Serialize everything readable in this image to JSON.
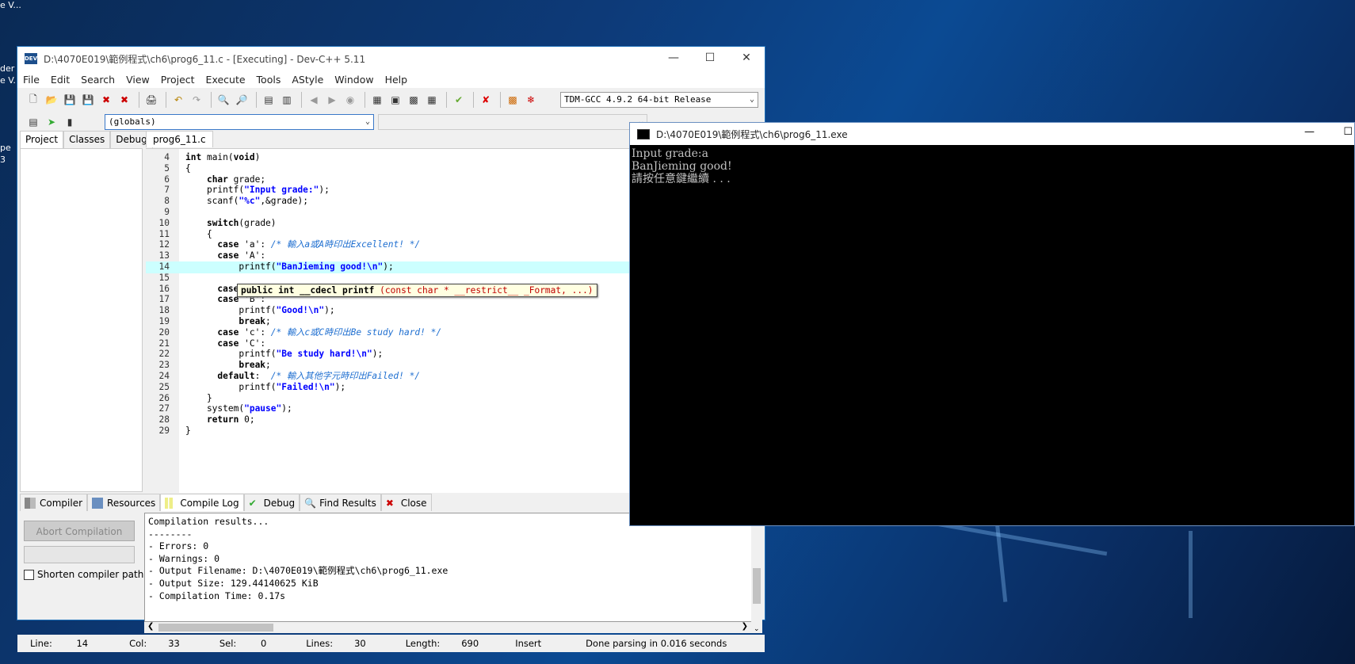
{
  "desktop": {
    "text1": "der",
    "text2": "e V..",
    "text3": "pe",
    "text4": "3",
    "text0": "e V..."
  },
  "devcpp": {
    "title": "D:\\4070E019\\範例程式\\ch6\\prog6_11.c - [Executing] - Dev-C++ 5.11",
    "menu": [
      "File",
      "Edit",
      "Search",
      "View",
      "Project",
      "Execute",
      "Tools",
      "AStyle",
      "Window",
      "Help"
    ],
    "compiler_select": "TDM-GCC 4.9.2 64-bit Release",
    "scope_select": "(globals)",
    "left_tabs": [
      "Project",
      "Classes",
      "Debug"
    ],
    "editor_tab": "prog6_11.c",
    "code_lines": [
      {
        "n": "4",
        "code": "int main(void)"
      },
      {
        "n": "5",
        "code": "{"
      },
      {
        "n": "6",
        "code": "    char grade;"
      },
      {
        "n": "7",
        "code": "    printf(\"Input grade:\");"
      },
      {
        "n": "8",
        "code": "    scanf(\"%c\",&grade);"
      },
      {
        "n": "9",
        "code": ""
      },
      {
        "n": "10",
        "code": "    switch(grade)"
      },
      {
        "n": "11",
        "code": "    {"
      },
      {
        "n": "12",
        "code": "      case 'a': /* 輸入a或A時印出Excellent! */"
      },
      {
        "n": "13",
        "code": "      case 'A':"
      },
      {
        "n": "14",
        "code": "          printf(\"BanJieming good!\\n\");"
      },
      {
        "n": "15",
        "code": ""
      },
      {
        "n": "16",
        "code": "      case 'b': /* 輸入b或B時印出Good! */"
      },
      {
        "n": "17",
        "code": "      case 'B':"
      },
      {
        "n": "18",
        "code": "          printf(\"Good!\\n\");"
      },
      {
        "n": "19",
        "code": "          break;"
      },
      {
        "n": "20",
        "code": "      case 'c': /* 輸入c或C時印出Be study hard! */"
      },
      {
        "n": "21",
        "code": "      case 'C':"
      },
      {
        "n": "22",
        "code": "          printf(\"Be study hard!\\n\");"
      },
      {
        "n": "23",
        "code": "          break;"
      },
      {
        "n": "24",
        "code": "      default:  /* 輸入其他字元時印出Failed! */"
      },
      {
        "n": "25",
        "code": "          printf(\"Failed!\\n\");"
      },
      {
        "n": "26",
        "code": "    }"
      },
      {
        "n": "27",
        "code": "    system(\"pause\");"
      },
      {
        "n": "28",
        "code": "    return 0;"
      },
      {
        "n": "29",
        "code": "}"
      }
    ],
    "tooltip": "public int __cdecl printf (const char * __restrict__ _Format, ...)",
    "bottom_tabs": [
      "Compiler",
      "Resources",
      "Compile Log",
      "Debug",
      "Find Results",
      "Close"
    ],
    "abort_button": "Abort Compilation",
    "shorten_paths": "Shorten compiler paths",
    "log_lines": [
      "Compilation results...",
      "--------",
      "- Errors: 0",
      "- Warnings: 0",
      "- Output Filename: D:\\4070E019\\範例程式\\ch6\\prog6_11.exe",
      "- Output Size: 129.44140625 KiB",
      "- Compilation Time: 0.17s"
    ],
    "status": {
      "line_label": "Line:",
      "line": "14",
      "col_label": "Col:",
      "col": "33",
      "sel_label": "Sel:",
      "sel": "0",
      "lines_label": "Lines:",
      "lines": "30",
      "length_label": "Length:",
      "length": "690",
      "mode": "Insert",
      "message": "Done parsing in 0.016 seconds"
    }
  },
  "console": {
    "title": "D:\\4070E019\\範例程式\\ch6\\prog6_11.exe",
    "lines": [
      "Input grade:a",
      "BanJieming good!",
      "請按任意鍵繼續 . . ."
    ]
  }
}
